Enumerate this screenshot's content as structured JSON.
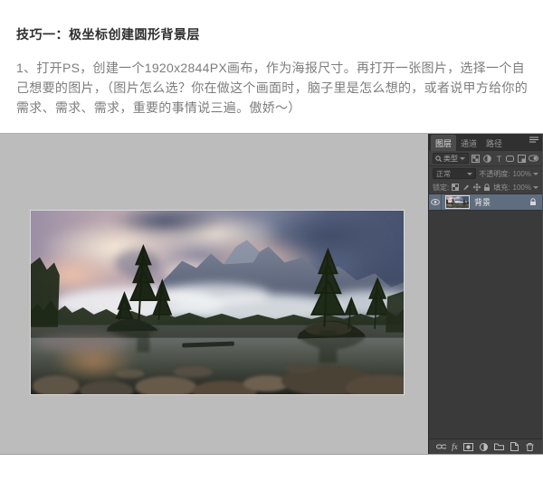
{
  "document": {
    "title": "技巧一：极坐标创建圆形背景层",
    "body_text": "1、打开PS，创建一个1920x2844PX画布，作为海报尺寸。再打开一张图片，选择一个自己想要的图片，（图片怎么选？你在做这个画面时，脑子里是怎么想的，或者说甲方给你的需求、需求、需求，重要的事情说三遍。傲娇～）"
  },
  "photoshop": {
    "panel": {
      "tabs": [
        {
          "label": "图层",
          "active": true
        },
        {
          "label": "通道",
          "active": false
        },
        {
          "label": "路径",
          "active": false
        }
      ],
      "filter_row": {
        "kind_label": "类型"
      },
      "blend_row": {
        "mode": "正常",
        "opacity_label": "不透明度:",
        "opacity_value": "100%"
      },
      "lock_row": {
        "lock_label": "锁定:",
        "fill_label": "填充:",
        "fill_value": "100%"
      },
      "layers": [
        {
          "name": "背景",
          "visible": true,
          "locked": true,
          "selected": true
        }
      ],
      "fx_label": "fx"
    },
    "colors": {
      "canvas_bg": "#bcbcbc",
      "panel_bg": "#3e3e3e",
      "panel_dark": "#303030",
      "selected_layer_bg": "#5f6e7e",
      "panel_text": "#bdbdbd"
    }
  }
}
